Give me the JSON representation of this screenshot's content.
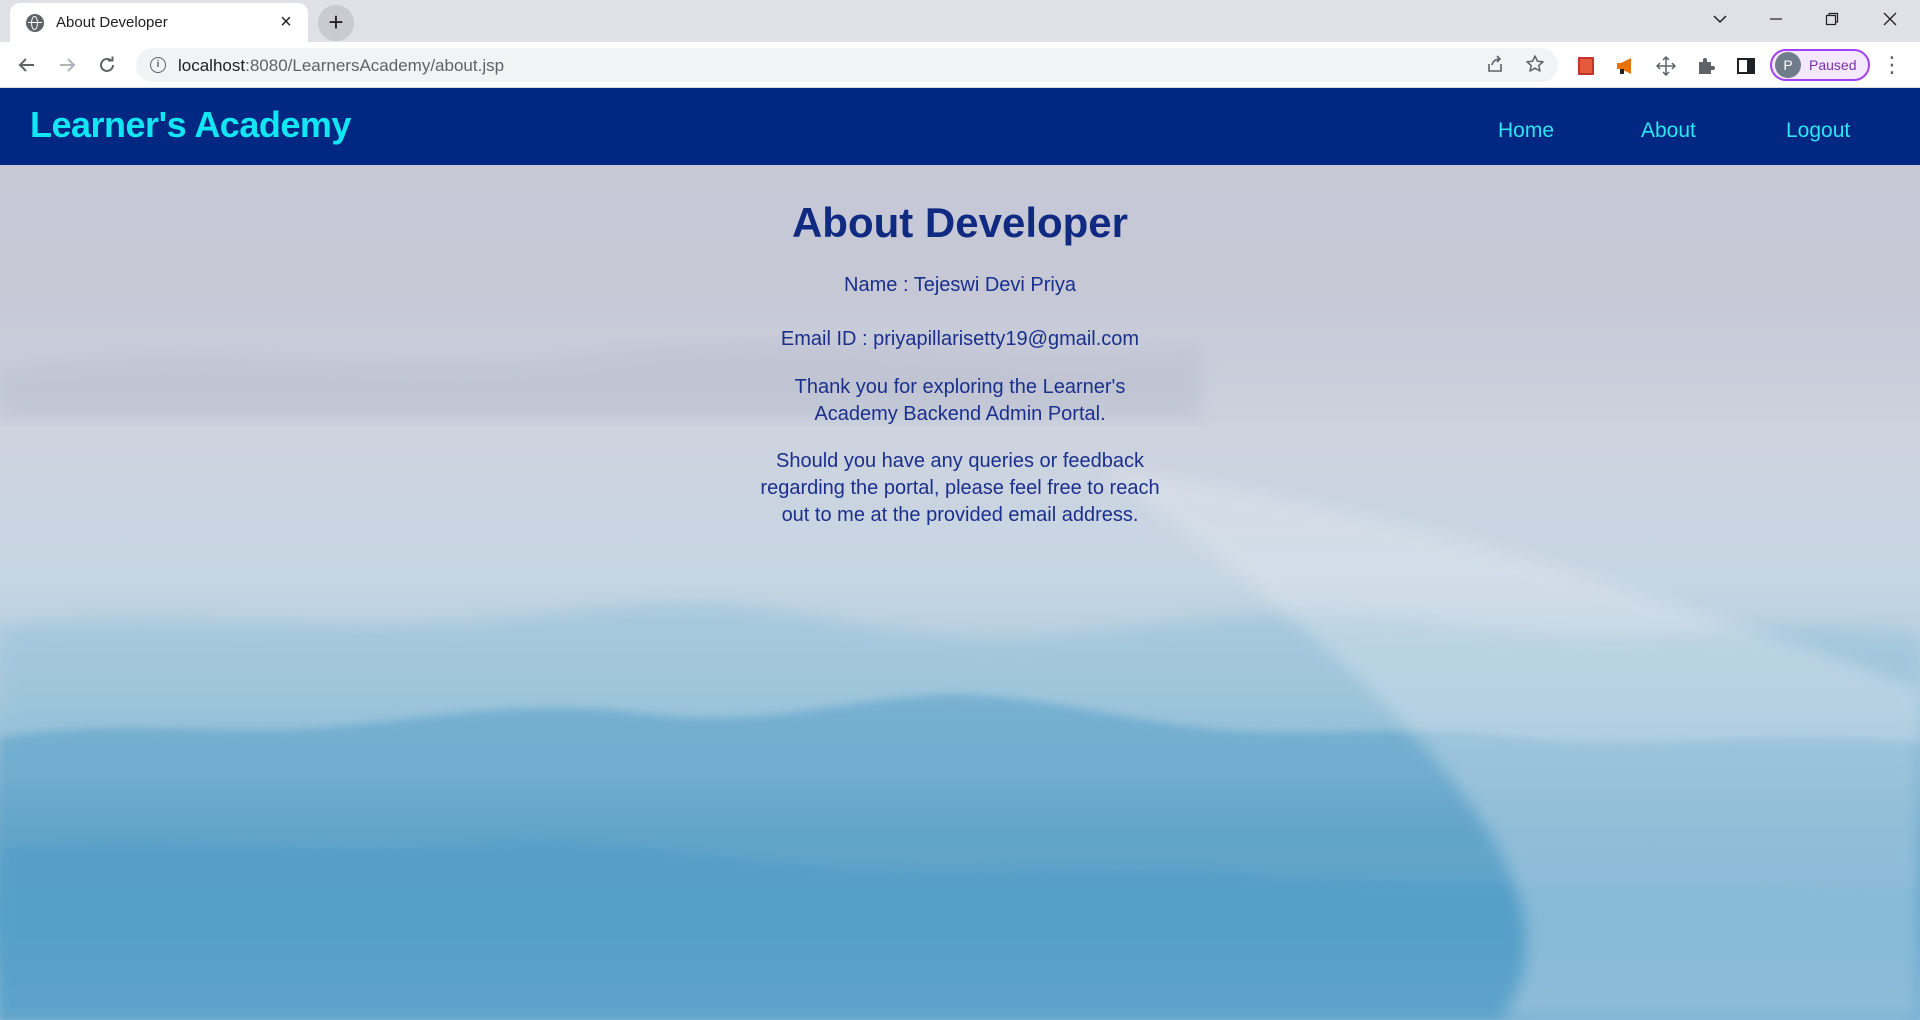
{
  "browser": {
    "tab_title": "About Developer",
    "tab_close": "×",
    "new_tab": "+",
    "url_host": "localhost",
    "url_rest": ":8080/LearnersAcademy/about.jsp",
    "profile_initial": "P",
    "profile_status": "Paused",
    "icons": [
      "globe-icon",
      "close-icon",
      "plus-icon",
      "chevron-down-icon",
      "minimize-icon",
      "maximize-icon",
      "close-icon",
      "back-arrow-icon",
      "forward-arrow-icon",
      "reload-icon",
      "info-icon",
      "share-icon",
      "star-icon",
      "puzzle-icon",
      "side-panel-icon",
      "kebab-menu-icon"
    ]
  },
  "site": {
    "brand": "Learner's Academy",
    "nav": {
      "home": "Home",
      "about": "About",
      "logout": "Logout"
    },
    "brand_color": "#12e6f2",
    "navbar_color": "#002882"
  },
  "content": {
    "heading": "About Developer",
    "name_line": "Name : Tejeswi Devi Priya",
    "email_line": "Email ID : priyapillarisetty19@gmail.com",
    "para1": "Thank you for exploring the Learner's Academy Backend Admin Portal.",
    "para2": "Should you have any queries or feedback regarding the portal, please feel free to reach out to me at the provided email address."
  }
}
